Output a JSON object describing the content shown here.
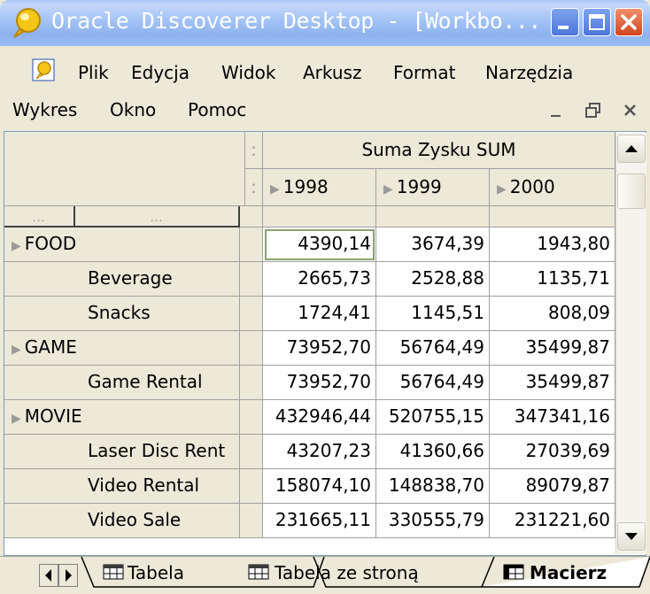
{
  "window": {
    "title": "Oracle Discoverer Desktop - [Workbo...",
    "title_icon": "oracle-discoverer-bulb-icon"
  },
  "menubar": {
    "row1": [
      "Plik",
      "Edycja",
      "Widok",
      "Arkusz",
      "Format",
      "Narzędzia"
    ],
    "row2": [
      "Wykres",
      "Okno",
      "Pomoc"
    ]
  },
  "grid": {
    "measure_header": "Suma Zysku SUM",
    "columns": [
      "1998",
      "1999",
      "2000"
    ],
    "dots_left": "...",
    "dots_right": "...",
    "rows": [
      {
        "label": "FOOD",
        "level": 1,
        "values": [
          "4390,14",
          "3674,39",
          "1943,80"
        ]
      },
      {
        "label": "Beverage",
        "level": 2,
        "values": [
          "2665,73",
          "2528,88",
          "1135,71"
        ]
      },
      {
        "label": "Snacks",
        "level": 2,
        "values": [
          "1724,41",
          "1145,51",
          "808,09"
        ]
      },
      {
        "label": "GAME",
        "level": 1,
        "values": [
          "73952,70",
          "56764,49",
          "35499,87"
        ]
      },
      {
        "label": "Game Rental",
        "level": 2,
        "values": [
          "73952,70",
          "56764,49",
          "35499,87"
        ]
      },
      {
        "label": "MOVIE",
        "level": 1,
        "values": [
          "432946,44",
          "520755,15",
          "347341,16"
        ]
      },
      {
        "label": "Laser Disc Rent",
        "level": 2,
        "values": [
          "43207,23",
          "41360,66",
          "27039,69"
        ]
      },
      {
        "label": "Video Rental",
        "level": 2,
        "values": [
          "158074,10",
          "148838,70",
          "89079,87"
        ]
      },
      {
        "label": "Video Sale",
        "level": 2,
        "values": [
          "231665,11",
          "330555,79",
          "231221,60"
        ]
      }
    ]
  },
  "sheet_tabs": [
    {
      "label": "Tabela",
      "active": false
    },
    {
      "label": "Tabela ze stroną",
      "active": false
    },
    {
      "label": "Macierz",
      "active": true
    }
  ],
  "colors": {
    "titlebar": "#9bbcf2",
    "chrome": "#ece9d8",
    "selected_cell_border": "#8aa070",
    "close_button": "#d0451e"
  }
}
